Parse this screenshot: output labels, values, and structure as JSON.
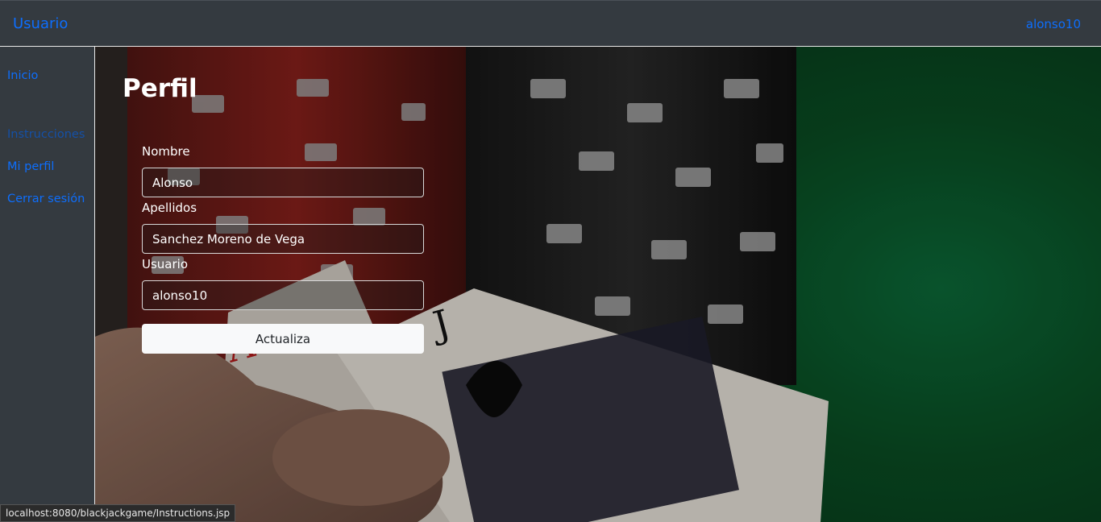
{
  "navbar": {
    "brand": "Usuario",
    "user": "alonso10"
  },
  "sidebar": {
    "items": [
      {
        "label": "Inicio"
      },
      {
        "label": "Instrucciones"
      },
      {
        "label": "Mi perfil"
      },
      {
        "label": "Cerrar sesión"
      }
    ]
  },
  "main": {
    "title": "Perfil",
    "fields": [
      {
        "label": "Nombre",
        "value": "Alonso"
      },
      {
        "label": "Apellidos",
        "value": "Sanchez Moreno de Vega"
      },
      {
        "label": "Usuario",
        "value": "alonso10"
      }
    ],
    "submit_label": "Actualiza"
  },
  "statusbar": {
    "url": "localhost:8080/blackjackgame/Instructions.jsp"
  },
  "colors": {
    "link": "#0d6efd",
    "chrome": "#343a40",
    "felt": "#0b5f33"
  }
}
